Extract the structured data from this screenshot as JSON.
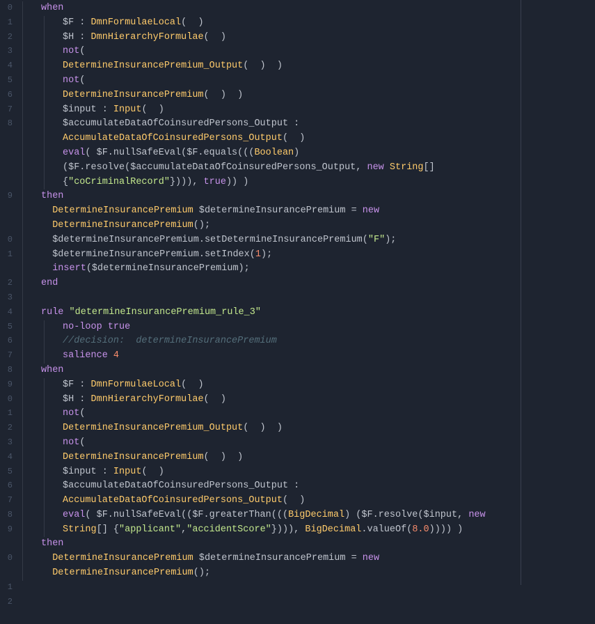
{
  "gutter": [
    "0",
    "1",
    "2",
    "3",
    "4",
    "5",
    "6",
    "7",
    "8",
    "",
    "",
    "",
    "",
    "9",
    "",
    "",
    "0",
    "1",
    "",
    "2",
    "3",
    "4",
    "5",
    "6",
    "7",
    "8",
    "9",
    "0",
    "1",
    "2",
    "3",
    "4",
    "5",
    "6",
    "7",
    "8",
    "9",
    "",
    "0",
    "",
    "1",
    "2",
    ""
  ],
  "lines": [
    {
      "i": 1,
      "t": "when"
    },
    {
      "i": 2,
      "t": "$F : DmnFormulaeLocal(  )"
    },
    {
      "i": 2,
      "t": "$H : DmnHierarchyFormulae(  )"
    },
    {
      "i": 2,
      "t": "not("
    },
    {
      "i": 2,
      "t": "DetermineInsurancePremium_Output(  )  )"
    },
    {
      "i": 2,
      "t": "not("
    },
    {
      "i": 2,
      "t": "DetermineInsurancePremium(  )  )"
    },
    {
      "i": 2,
      "t": "$input : Input(  )"
    },
    {
      "i": 2,
      "t": "$accumulateDataOfCoinsuredPersons_Output :"
    },
    {
      "i": 2,
      "t": "AccumulateDataOfCoinsuredPersons_Output(  )"
    },
    {
      "i": 2,
      "t": "eval( $F.nullSafeEval($F.equals(((Boolean)"
    },
    {
      "i": 2,
      "t": "($F.resolve($accumulateDataOfCoinsuredPersons_Output, new String[]"
    },
    {
      "i": 2,
      "t": "{\"coCriminalRecord\"}))), true)) )"
    },
    {
      "i": 1,
      "t": "then"
    },
    {
      "i": 1,
      "t": "  DetermineInsurancePremium $determineInsurancePremium = new"
    },
    {
      "i": 1,
      "t": "  DetermineInsurancePremium();"
    },
    {
      "i": 1,
      "t": "  $determineInsurancePremium.setDetermineInsurancePremium(\"F\");"
    },
    {
      "i": 1,
      "t": "  $determineInsurancePremium.setIndex(1);"
    },
    {
      "i": 1,
      "t": "  insert($determineInsurancePremium);"
    },
    {
      "i": 1,
      "t": "end"
    },
    {
      "i": 1,
      "t": ""
    },
    {
      "i": 1,
      "t": "rule \"determineInsurancePremium_rule_3\""
    },
    {
      "i": 2,
      "t": "no-loop true"
    },
    {
      "i": 2,
      "t": "//decision:  determineInsurancePremium"
    },
    {
      "i": 2,
      "t": "salience 4"
    },
    {
      "i": 1,
      "t": "when"
    },
    {
      "i": 2,
      "t": "$F : DmnFormulaeLocal(  )"
    },
    {
      "i": 2,
      "t": "$H : DmnHierarchyFormulae(  )"
    },
    {
      "i": 2,
      "t": "not("
    },
    {
      "i": 2,
      "t": "DetermineInsurancePremium_Output(  )  )"
    },
    {
      "i": 2,
      "t": "not("
    },
    {
      "i": 2,
      "t": "DetermineInsurancePremium(  )  )"
    },
    {
      "i": 2,
      "t": "$input : Input(  )"
    },
    {
      "i": 2,
      "t": "$accumulateDataOfCoinsuredPersons_Output :"
    },
    {
      "i": 2,
      "t": "AccumulateDataOfCoinsuredPersons_Output(  )"
    },
    {
      "i": 2,
      "t": "eval( $F.nullSafeEval(($F.greaterThan(((BigDecimal) ($F.resolve($input, new"
    },
    {
      "i": 2,
      "t": "String[] {\"applicant\",\"accidentScore\"}))), BigDecimal.valueOf(8.0)))) )"
    },
    {
      "i": 1,
      "t": "then"
    },
    {
      "i": 1,
      "t": "  DetermineInsurancePremium $determineInsurancePremium = new"
    },
    {
      "i": 1,
      "t": "  DetermineInsurancePremium();"
    }
  ]
}
